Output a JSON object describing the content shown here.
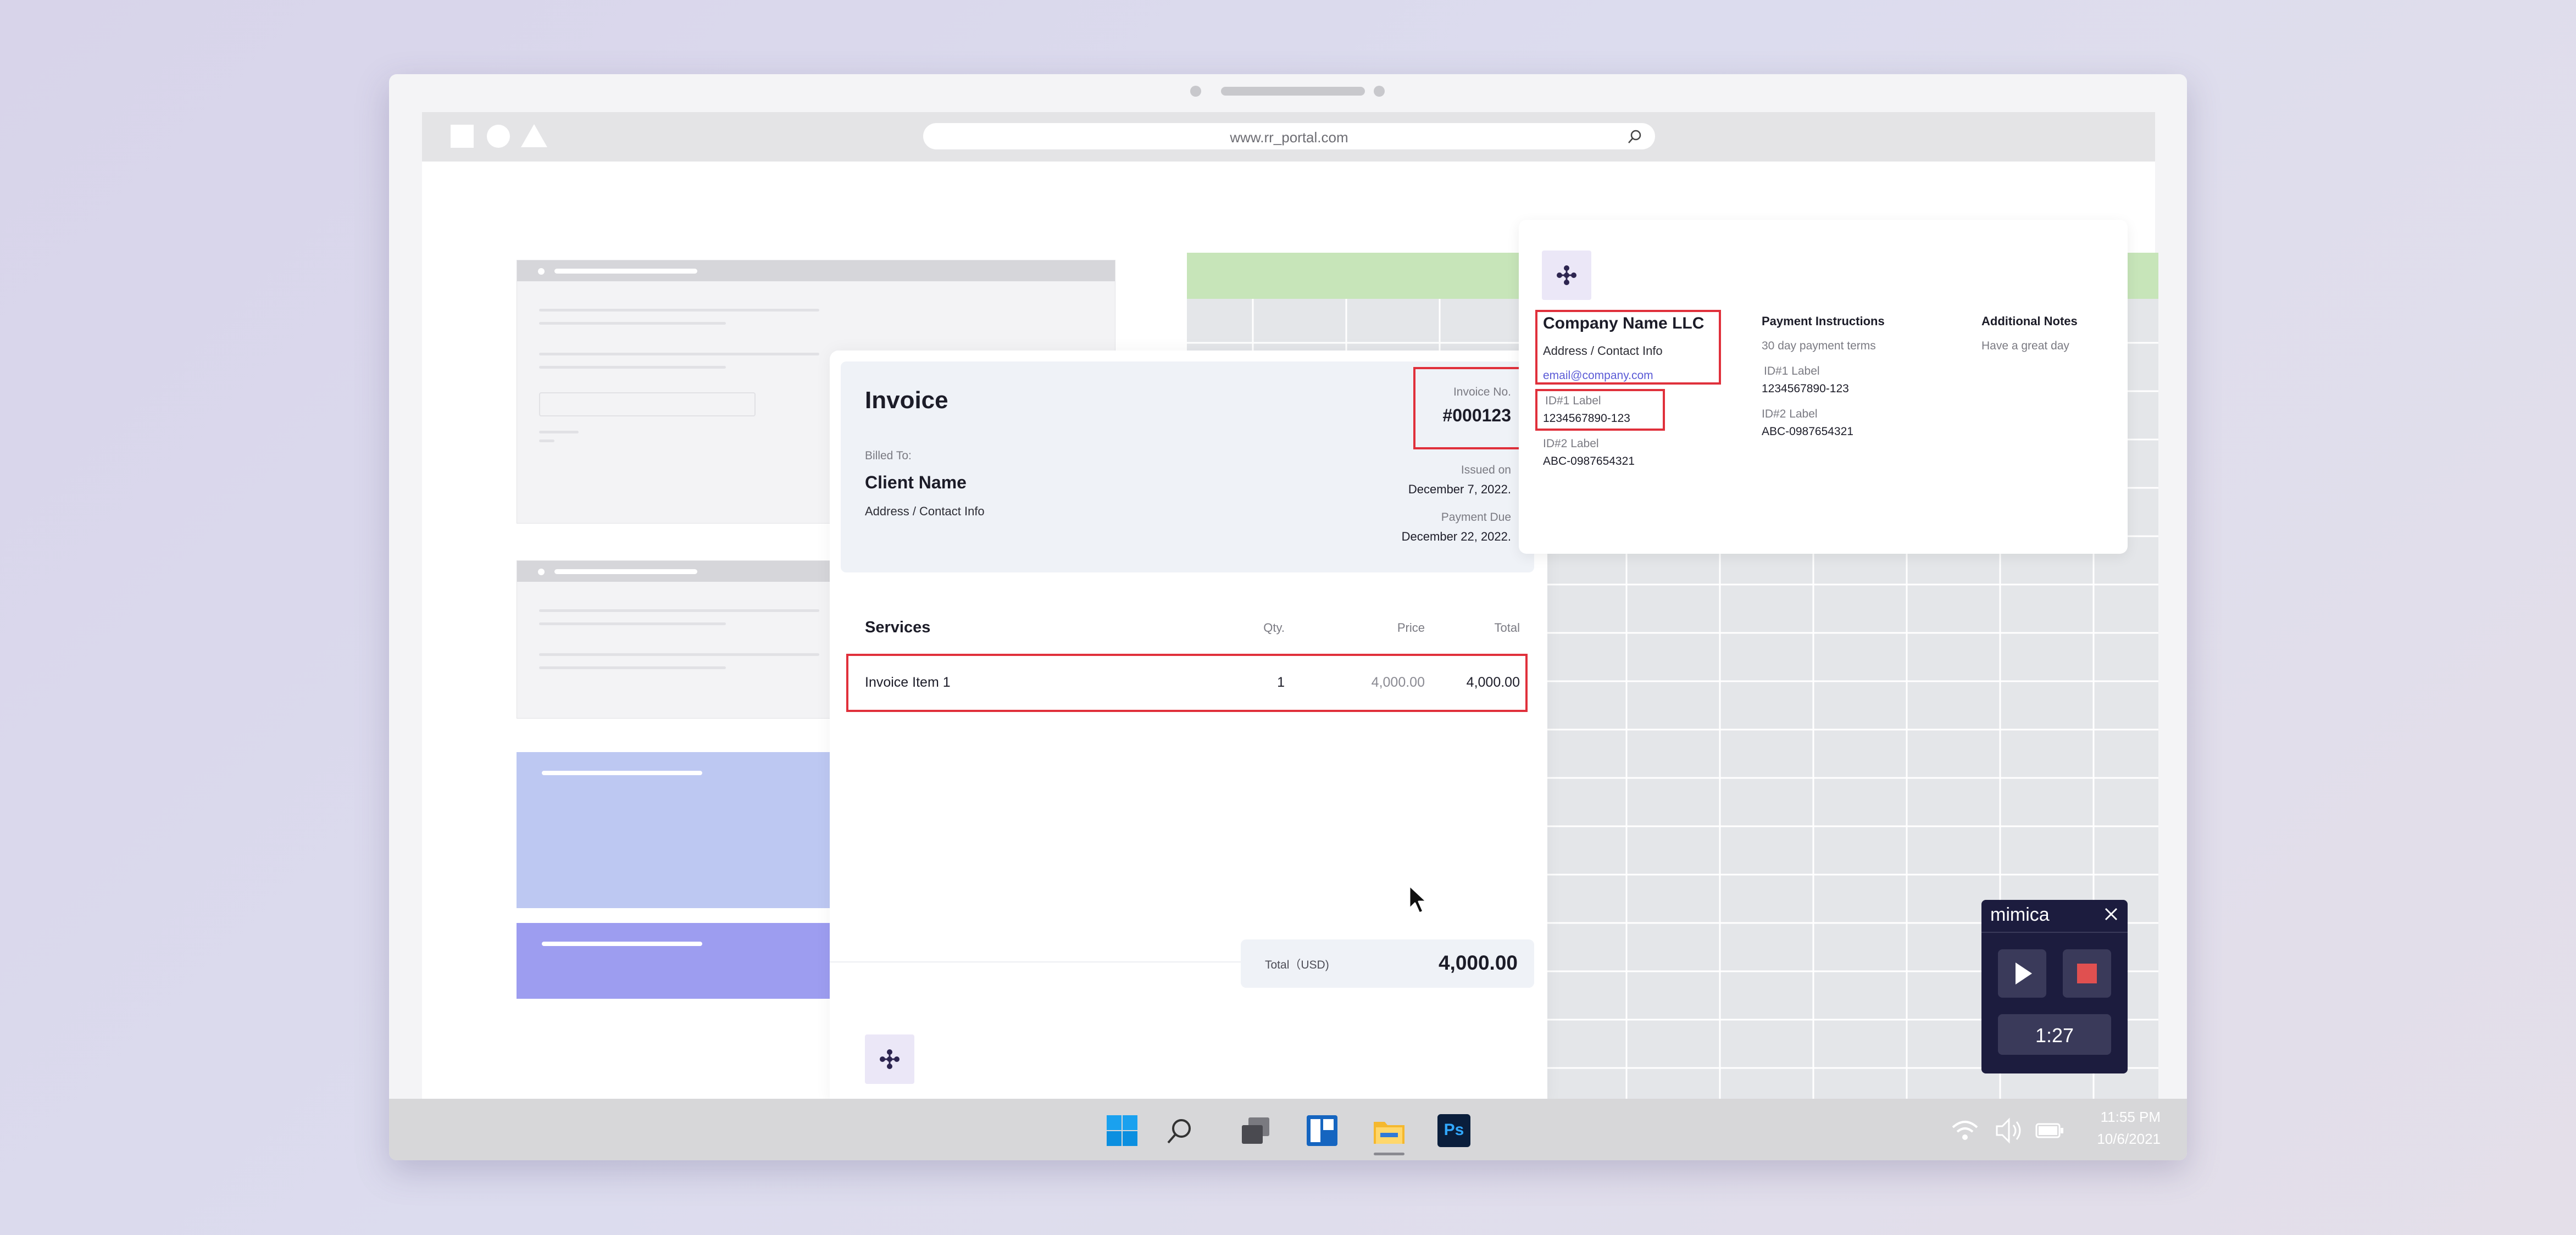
{
  "browser": {
    "url": "www.rr_portal.com"
  },
  "invoice": {
    "title": "Invoice",
    "invoice_no_label": "Invoice No.",
    "invoice_no": "#000123",
    "billed_to_label": "Billed To:",
    "client_name": "Client Name",
    "client_address": "Address / Contact Info",
    "issued_label": "Issued on",
    "issued_date": "December 7, 2022.",
    "due_label": "Payment Due",
    "due_date": "December 22, 2022.",
    "table": {
      "headers": {
        "services": "Services",
        "qty": "Qty.",
        "price": "Price",
        "total": "Total"
      },
      "rows": [
        {
          "item": "Invoice Item 1",
          "qty": "1",
          "price": "4,000.00",
          "total": "4,000.00"
        }
      ]
    },
    "total_label": "Total（USD)",
    "total_value": "4,000.00"
  },
  "company": {
    "name": "Company Name LLC",
    "address": "Address / Contact Info",
    "email": "email@company.com",
    "id1_label": "ID#1 Label",
    "id1_value": "1234567890-123",
    "id2_label": "ID#2 Label",
    "id2_value": "ABC-0987654321",
    "payment": {
      "title": "Payment Instructions",
      "terms": "30 day payment terms",
      "id1_label": "ID#1 Label",
      "id1_value": "1234567890-123",
      "id2_label": "ID#2 Label",
      "id2_value": "ABC-0987654321"
    },
    "notes": {
      "title": "Additional Notes",
      "text": "Have a great day"
    }
  },
  "mimica": {
    "brand": "mimica",
    "timer": "1:27"
  },
  "taskbar": {
    "icons": [
      "windows-start-icon",
      "search-icon",
      "task-view-icon",
      "widgets-icon",
      "file-explorer-icon",
      "photoshop-icon"
    ],
    "ps_label": "Ps",
    "time": "11:55 PM",
    "date": "10/6/2021"
  },
  "colors": {
    "accent_red": "#e0303b",
    "logo_purple": "#2d2550",
    "sheet_header_green": "#c7e5b9",
    "card_blue": "#bdc8f2",
    "card_violet": "#9d9df0",
    "mimica_bg": "#1c1c3e"
  }
}
